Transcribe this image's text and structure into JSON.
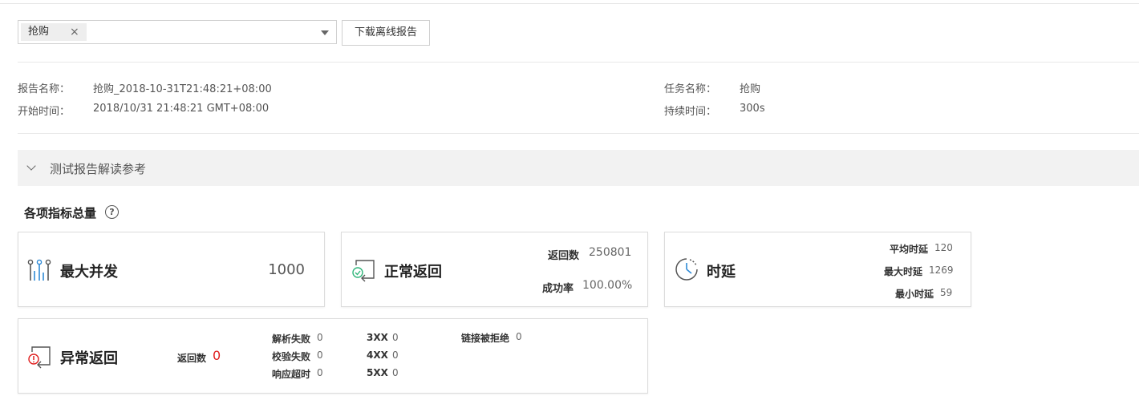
{
  "toolbar": {
    "selected_tag": "抢购",
    "tag_remove": "×",
    "download_button": "下载离线报告"
  },
  "report_info": {
    "report_name_label": "报告名称：",
    "report_name": "抢购_2018-10-31T21:48:21+08:00",
    "start_time_label": "开始时间：",
    "start_time": "2018/10/31 21:48:21 GMT+08:00",
    "task_name_label": "任务名称：",
    "task_name": "抢购",
    "duration_label": "持续时间：",
    "duration": "300s"
  },
  "guide": {
    "label": "测试报告解读参考"
  },
  "metrics": {
    "title": "各项指标总量",
    "help": "?",
    "max_concurrency": {
      "label": "最大并发",
      "value": "1000"
    },
    "normal_return": {
      "label": "正常返回",
      "count_label": "返回数",
      "count": "250801",
      "success_label": "成功率",
      "success": "100.00%"
    },
    "latency": {
      "label": "时延",
      "avg_label": "平均时延",
      "avg": "120",
      "max_label": "最大时延",
      "max": "1269",
      "min_label": "最小时延",
      "min": "59"
    },
    "abnormal_return": {
      "label": "异常返回",
      "count_label": "返回数",
      "count": "0",
      "parse_fail_label": "解析失败",
      "parse_fail": "0",
      "verify_fail_label": "校验失败",
      "verify_fail": "0",
      "timeout_label": "响应超时",
      "timeout": "0",
      "c3xx_label": "3XX",
      "c3xx": "0",
      "c4xx_label": "4XX",
      "c4xx": "0",
      "c5xx_label": "5XX",
      "c5xx": "0",
      "refused_label": "链接被拒绝",
      "refused": "0"
    }
  },
  "colors": {
    "accent": "#2f8ad6",
    "success": "#2fb57a",
    "error": "#e02020"
  }
}
